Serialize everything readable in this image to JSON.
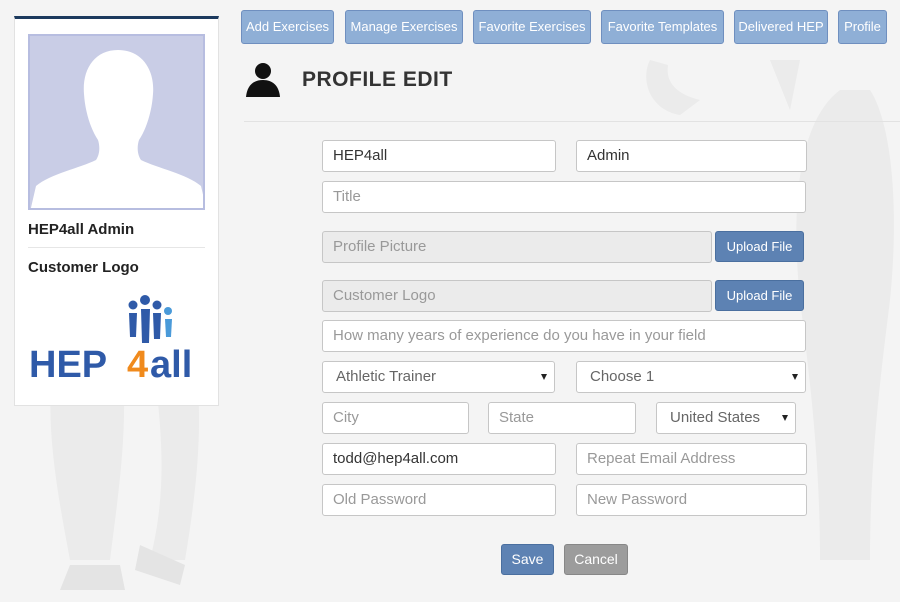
{
  "nav": {
    "items": [
      {
        "label": "Add Exercises"
      },
      {
        "label": "Manage Exercises"
      },
      {
        "label": "Favorite Exercises"
      },
      {
        "label": "Favorite Templates"
      },
      {
        "label": "Delivered HEP"
      },
      {
        "label": "Profile"
      }
    ]
  },
  "profile_card": {
    "name": "HEP4all Admin",
    "logo_label": "Customer Logo",
    "logo_text_left": "HEP",
    "logo_text_number": "4",
    "logo_text_right": "all"
  },
  "page": {
    "title": "PROFILE EDIT"
  },
  "form": {
    "first_name": "HEP4all",
    "last_name": "Admin",
    "title_placeholder": "Title",
    "profile_picture_placeholder": "Profile Picture",
    "customer_logo_placeholder": "Customer Logo",
    "upload_label": "Upload File",
    "experience_placeholder": "How many years of experience do you have in your field",
    "profession_value": "Athletic Trainer",
    "second_select_value": "Choose 1",
    "city_placeholder": "City",
    "state_placeholder": "State",
    "country_value": "United States",
    "email": "todd@hep4all.com",
    "repeat_email_placeholder": "Repeat Email Address",
    "old_password_placeholder": "Old Password",
    "new_password_placeholder": "New Password",
    "save_label": "Save",
    "cancel_label": "Cancel"
  },
  "colors": {
    "nav_button": "#8fafd6",
    "primary_button": "#5d82b3",
    "cancel_button": "#9c9c9c",
    "card_top_border": "#1c3a5e",
    "avatar_bg": "#c9cde6",
    "logo_blue": "#2f5aa8",
    "logo_orange": "#f08a1c"
  }
}
